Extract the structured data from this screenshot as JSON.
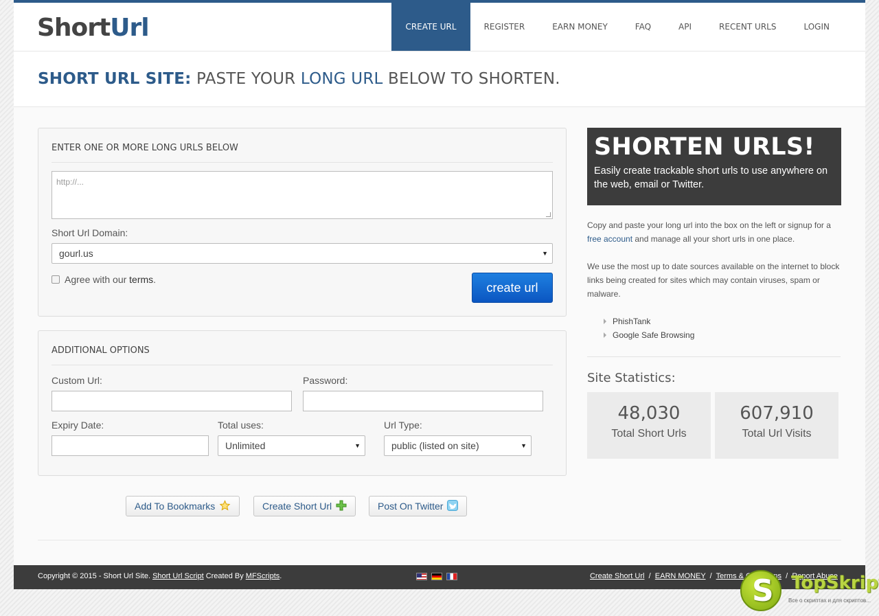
{
  "logo": {
    "part1": "Short",
    "part2": "Url"
  },
  "nav": [
    {
      "label": "CREATE URL",
      "active": true
    },
    {
      "label": "REGISTER"
    },
    {
      "label": "EARN MONEY"
    },
    {
      "label": "FAQ"
    },
    {
      "label": "API"
    },
    {
      "label": "RECENT URLS"
    },
    {
      "label": "LOGIN"
    }
  ],
  "headline": {
    "bold": "SHORT URL SITE:",
    "t1": " PASTE YOUR ",
    "blue": "LONG URL",
    "t2": " BELOW TO SHORTEN."
  },
  "main_panel": {
    "title": "ENTER ONE OR MORE LONG URLS BELOW",
    "urls_placeholder": "http://...",
    "domain_label": "Short Url Domain:",
    "domain_value": "gourl.us",
    "agree_prefix": "Agree with our ",
    "agree_link": "terms",
    "agree_suffix": ".",
    "submit_label": "create url"
  },
  "options_panel": {
    "title": "ADDITIONAL OPTIONS",
    "custom_url_label": "Custom Url:",
    "password_label": "Password:",
    "expiry_label": "Expiry Date:",
    "uses_label": "Total uses:",
    "uses_value": "Unlimited",
    "type_label": "Url Type:",
    "type_value": "public (listed on site)"
  },
  "actions": {
    "bookmarks": "Add To Bookmarks",
    "create": "Create Short Url",
    "twitter": "Post On Twitter"
  },
  "promo": {
    "title": "SHORTEN URLS!",
    "text": "Easily create trackable short urls to use anywhere on the web, email or Twitter."
  },
  "info": {
    "p1_a": "Copy and paste your long url into the box on the left or signup for a ",
    "p1_link": "free account",
    "p1_b": " and manage all your short urls in one place.",
    "p2": "We use the most up to date sources available on the internet to block links being created for sites which may contain viruses, spam or malware.",
    "sources": [
      "PhishTank",
      "Google Safe Browsing"
    ]
  },
  "stats": {
    "title": "Site Statistics:",
    "items": [
      {
        "value": "48,030",
        "label": "Total Short Urls"
      },
      {
        "value": "607,910",
        "label": "Total Url Visits"
      }
    ]
  },
  "footer": {
    "copy": "Copyright © 2015 - Short Url Site. ",
    "script_link": "Short Url Script",
    "created_by": " Created By ",
    "author_link": "MFScripts",
    "end": ".",
    "links": [
      "Create Short Url",
      "EARN MONEY",
      "Terms & Conditions",
      "Report Abuse"
    ],
    "sep": "/"
  },
  "watermark": {
    "letter": "S",
    "brand": "TopSkript",
    "tagline": "Все о скриптах и для скриптов..."
  },
  "colors": {
    "brand": "#2d5b8a",
    "button": "#0b56c1",
    "footer": "#3c3c3c",
    "promo": "#3c3c3c"
  }
}
